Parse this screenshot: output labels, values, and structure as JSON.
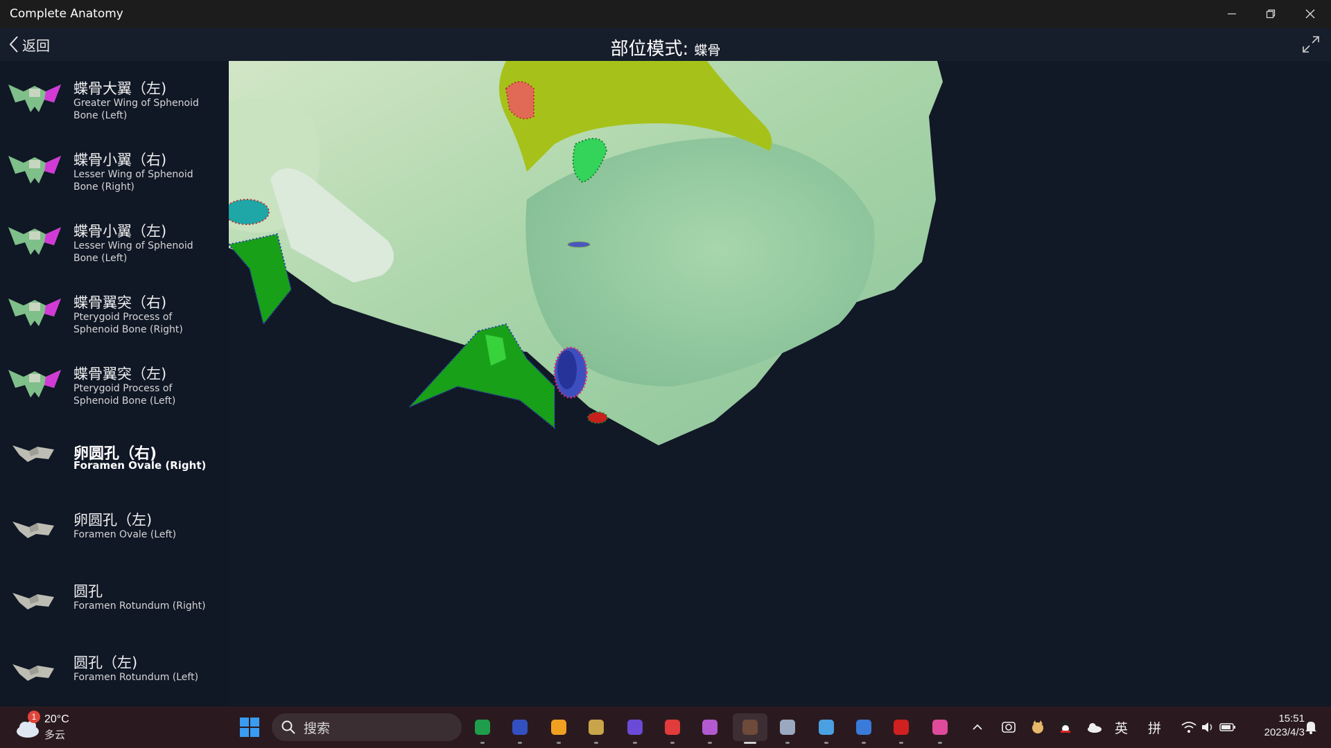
{
  "window": {
    "title": "Complete Anatomy"
  },
  "header": {
    "back_label": "返回",
    "mode_label": "部位模式:",
    "mode_value": "蝶骨"
  },
  "sidebar": {
    "items": [
      {
        "cn": "蝶骨大翼（左)",
        "en": "Greater Wing of Sphenoid Bone (Left)",
        "icon": "sphenoid-thumbnail-icon"
      },
      {
        "cn": "蝶骨小翼（右)",
        "en": "Lesser Wing of Sphenoid Bone (Right)",
        "icon": "sphenoid-thumbnail-icon"
      },
      {
        "cn": "蝶骨小翼（左)",
        "en": "Lesser Wing of Sphenoid Bone (Left)",
        "icon": "sphenoid-thumbnail-icon"
      },
      {
        "cn": "蝶骨翼突（右)",
        "en": "Pterygoid Process of Sphenoid Bone (Right)",
        "icon": "sphenoid-thumbnail-icon"
      },
      {
        "cn": "蝶骨翼突（左)",
        "en": "Pterygoid Process of Sphenoid Bone (Left)",
        "icon": "sphenoid-thumbnail-icon"
      },
      {
        "cn": "卵圆孔（右)",
        "en": "Foramen Ovale (Right)",
        "icon": "sphenoid-thumbnail-icon",
        "selected": true
      },
      {
        "cn": "卵圆孔（左)",
        "en": "Foramen Ovale (Left)",
        "icon": "sphenoid-thumbnail-icon"
      },
      {
        "cn": "圆孔",
        "en": "Foramen Rotundum (Right)",
        "icon": "sphenoid-thumbnail-icon"
      },
      {
        "cn": "圆孔（左)",
        "en": "Foramen Rotundum (Left)",
        "icon": "sphenoid-thumbnail-icon"
      }
    ]
  },
  "colors": {
    "bone": "#a8d4a8",
    "wing_highlight": "#a6c21a",
    "foramen_blue": "#2e3fa0",
    "foramen_red": "#c8201c",
    "pterygoid_green": "#19a019",
    "thumb_magenta": "#d23ad6"
  },
  "taskbar": {
    "weather": {
      "badge": "1",
      "temp": "20°C",
      "desc": "多云"
    },
    "search_placeholder": "搜索",
    "apps": [
      "windows-start-icon",
      "spreadsheet-app-icon",
      "game-app-icon",
      "chrome-like-app-icon",
      "league-app-icon",
      "crystal-app-icon",
      "netease-music-icon",
      "purple-app-icon",
      "complete-anatomy-icon",
      "notepad-app-icon",
      "chart-app-icon",
      "blue-app-icon",
      "acrobat-icon",
      "colorful-app-icon"
    ],
    "tray": {
      "lang1": "英",
      "lang2": "拼"
    },
    "clock": {
      "time": "15:51",
      "date": "2023/4/3"
    }
  }
}
